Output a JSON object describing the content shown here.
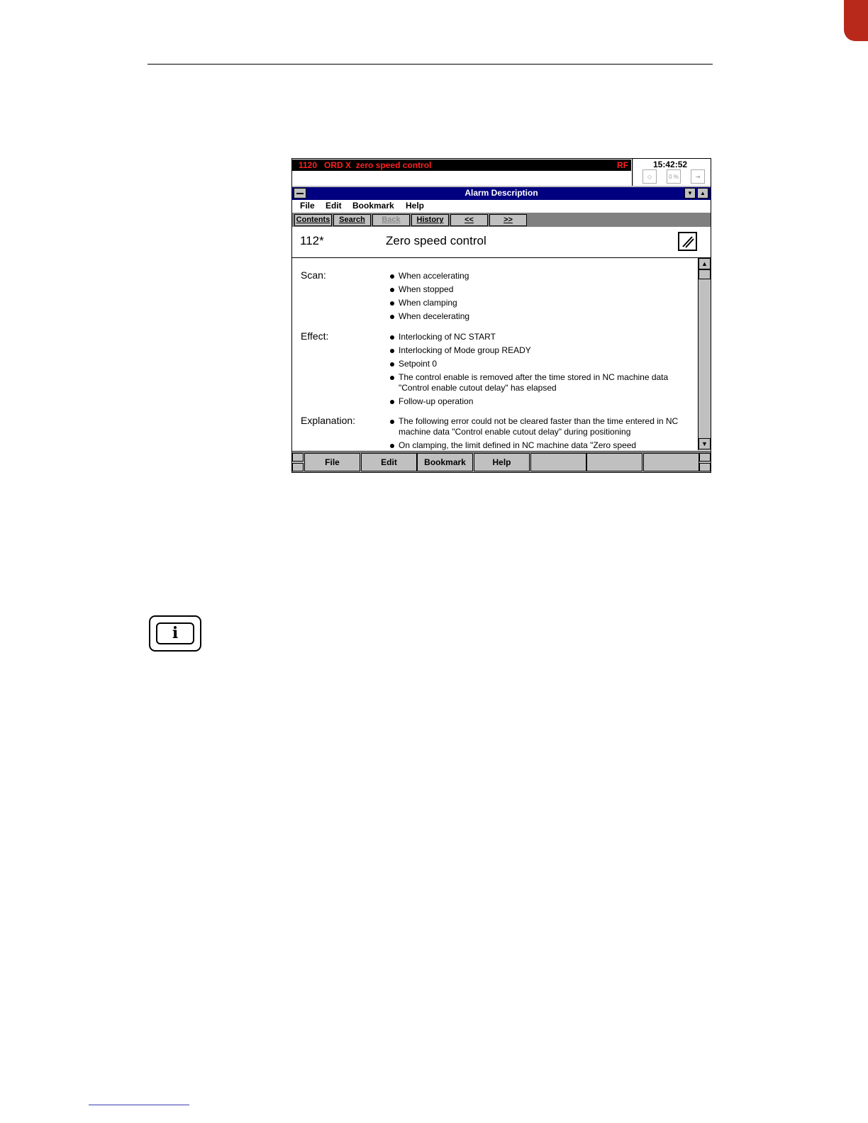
{
  "alarm_line": {
    "message": "1120   ORD X  zero speed control",
    "tag": "RF",
    "time": "15:42:52",
    "status_icons": [
      "feed-icon",
      "percent-icon",
      "exit-icon"
    ],
    "percent_label": "0 %"
  },
  "window": {
    "title": "Alarm Description",
    "menu": [
      "File",
      "Edit",
      "Bookmark",
      "Help"
    ],
    "buttons": [
      {
        "label": "Contents",
        "enabled": true
      },
      {
        "label": "Search",
        "enabled": true
      },
      {
        "label": "Back",
        "enabled": false
      },
      {
        "label": "History",
        "enabled": true
      },
      {
        "label": "<<",
        "enabled": true
      },
      {
        "label": ">>",
        "enabled": true
      }
    ]
  },
  "alarm": {
    "number": "112*",
    "title": "Zero speed control"
  },
  "sections": [
    {
      "label": "Scan:",
      "items": [
        "When accelerating",
        "When stopped",
        "When clamping",
        "When decelerating"
      ]
    },
    {
      "label": "Effect:",
      "items": [
        "Interlocking of NC START",
        "Interlocking of Mode group READY",
        "Setpoint 0",
        "The control enable is removed after the time stored in NC machine data \"Control enable cutout delay\" has elapsed",
        "Follow-up operation"
      ]
    },
    {
      "label": "Explanation:",
      "items": [
        "The following error could not be cleared faster than the time entered in NC machine data \"Control enable cutout delay\" during positioning",
        "On clamping, the limit defined in NC machine data \"Zero speed"
      ]
    }
  ],
  "softkeys": [
    "File",
    "Edit",
    "Bookmark",
    "Help",
    "",
    "",
    ""
  ],
  "colors": {
    "title_bar": "#000080",
    "alarm_text": "#ff2020",
    "chrome": "#c0c0c0"
  }
}
